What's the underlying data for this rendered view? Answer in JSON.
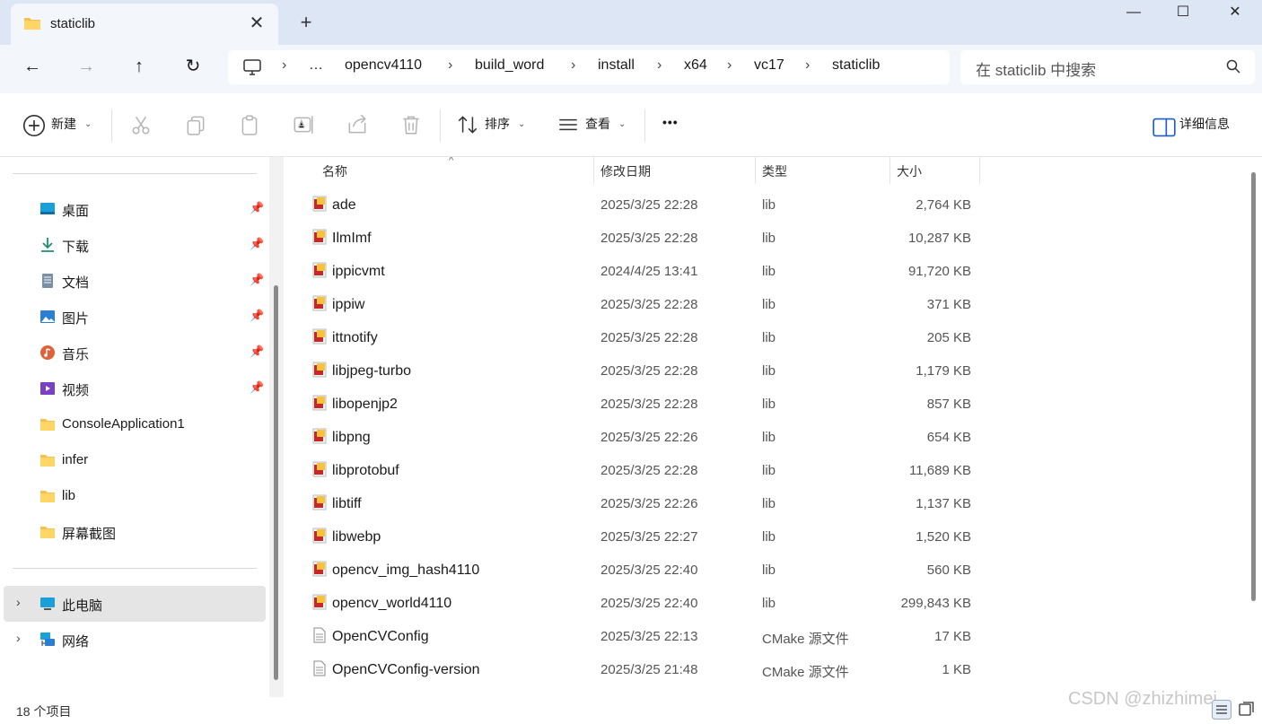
{
  "window": {
    "tab_title": "staticlib",
    "new_tab": "+",
    "close_tab": "✕",
    "minimize": "—",
    "maximize": "☐",
    "close": "✕"
  },
  "nav": {
    "back": "←",
    "forward": "→",
    "up": "↑",
    "refresh": "↻",
    "breadcrumbs": [
      "…",
      "opencv4110",
      "build_word",
      "install",
      "x64",
      "vc17",
      "staticlib"
    ],
    "separator": "›",
    "search_placeholder": "在 staticlib 中搜索"
  },
  "commands": {
    "new_label": "新建",
    "sort_label": "排序",
    "view_label": "查看",
    "more_label": "•••",
    "details_label": "详细信息"
  },
  "sidebar": {
    "quick_access": [
      {
        "label": "桌面",
        "icon": "desktop-icon",
        "pinned": true
      },
      {
        "label": "下载",
        "icon": "download-icon",
        "pinned": true
      },
      {
        "label": "文档",
        "icon": "documents-icon",
        "pinned": true
      },
      {
        "label": "图片",
        "icon": "pictures-icon",
        "pinned": true
      },
      {
        "label": "音乐",
        "icon": "music-icon",
        "pinned": true
      },
      {
        "label": "视频",
        "icon": "videos-icon",
        "pinned": true
      },
      {
        "label": "ConsoleApplication1",
        "icon": "folder-icon",
        "pinned": false
      },
      {
        "label": "infer",
        "icon": "folder-icon",
        "pinned": false
      },
      {
        "label": "lib",
        "icon": "folder-icon",
        "pinned": false
      },
      {
        "label": "屏幕截图",
        "icon": "folder-icon",
        "pinned": false
      }
    ],
    "this_pc": "此电脑",
    "network": "网络"
  },
  "columns": {
    "name": "名称",
    "date": "修改日期",
    "type": "类型",
    "size": "大小"
  },
  "files": [
    {
      "name": "ade",
      "date": "2025/3/25 22:28",
      "type": "lib",
      "size": "2,764 KB",
      "icon": "lib-file-icon"
    },
    {
      "name": "IlmImf",
      "date": "2025/3/25 22:28",
      "type": "lib",
      "size": "10,287 KB",
      "icon": "lib-file-icon"
    },
    {
      "name": "ippicvmt",
      "date": "2024/4/25 13:41",
      "type": "lib",
      "size": "91,720 KB",
      "icon": "lib-file-icon"
    },
    {
      "name": "ippiw",
      "date": "2025/3/25 22:28",
      "type": "lib",
      "size": "371 KB",
      "icon": "lib-file-icon"
    },
    {
      "name": "ittnotify",
      "date": "2025/3/25 22:28",
      "type": "lib",
      "size": "205 KB",
      "icon": "lib-file-icon"
    },
    {
      "name": "libjpeg-turbo",
      "date": "2025/3/25 22:28",
      "type": "lib",
      "size": "1,179 KB",
      "icon": "lib-file-icon"
    },
    {
      "name": "libopenjp2",
      "date": "2025/3/25 22:28",
      "type": "lib",
      "size": "857 KB",
      "icon": "lib-file-icon"
    },
    {
      "name": "libpng",
      "date": "2025/3/25 22:26",
      "type": "lib",
      "size": "654 KB",
      "icon": "lib-file-icon"
    },
    {
      "name": "libprotobuf",
      "date": "2025/3/25 22:28",
      "type": "lib",
      "size": "11,689 KB",
      "icon": "lib-file-icon"
    },
    {
      "name": "libtiff",
      "date": "2025/3/25 22:26",
      "type": "lib",
      "size": "1,137 KB",
      "icon": "lib-file-icon"
    },
    {
      "name": "libwebp",
      "date": "2025/3/25 22:27",
      "type": "lib",
      "size": "1,520 KB",
      "icon": "lib-file-icon"
    },
    {
      "name": "opencv_img_hash4110",
      "date": "2025/3/25 22:40",
      "type": "lib",
      "size": "560 KB",
      "icon": "lib-file-icon"
    },
    {
      "name": "opencv_world4110",
      "date": "2025/3/25 22:40",
      "type": "lib",
      "size": "299,843 KB",
      "icon": "lib-file-icon"
    },
    {
      "name": "OpenCVConfig",
      "date": "2025/3/25 22:13",
      "type": "CMake 源文件",
      "size": "17 KB",
      "icon": "text-file-icon"
    },
    {
      "name": "OpenCVConfig-version",
      "date": "2025/3/25 21:48",
      "type": "CMake 源文件",
      "size": "1 KB",
      "icon": "text-file-icon"
    }
  ],
  "status": {
    "item_count": "18 个项目"
  },
  "watermark": "CSDN @zhizhimei",
  "colors": {
    "titlebar": "#dce6f4",
    "navbar": "#f3f6fb",
    "selected": "#e5e5e5",
    "lib_icon": "#c62828"
  }
}
